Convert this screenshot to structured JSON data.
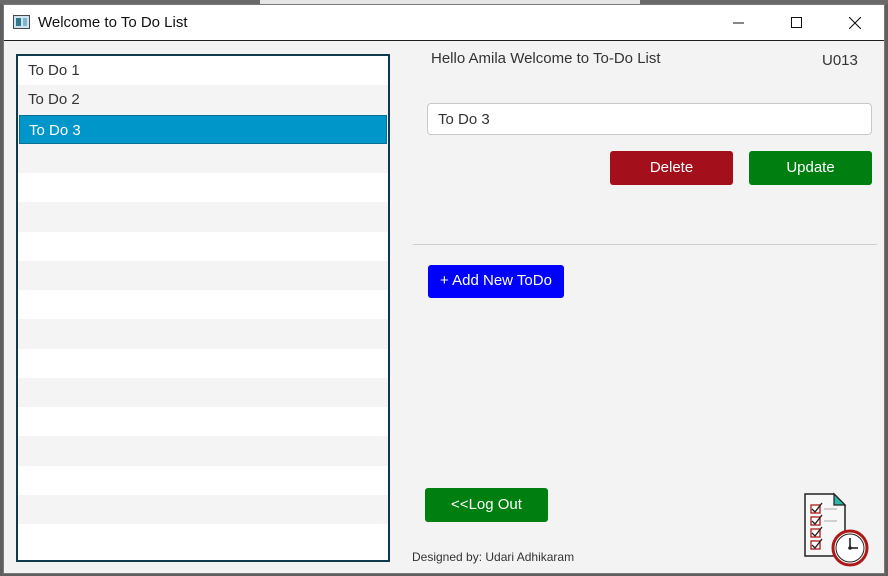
{
  "window": {
    "title": "Welcome to To Do List"
  },
  "todo_list": {
    "items": [
      "To Do 1",
      "To Do 2",
      "To Do 3"
    ],
    "selected_index": 2,
    "empty_rows": 14
  },
  "header": {
    "greeting": "Hello Amila Welcome to To-Do List",
    "user_id": "U013"
  },
  "editor": {
    "value": "To Do 3",
    "delete_label": "Delete",
    "update_label": "Update"
  },
  "actions": {
    "add_label": "+ Add New ToDo",
    "logout_label": "<<Log Out"
  },
  "footer": {
    "credit": "Designed by: Udari Adhikaram"
  },
  "icons": {
    "app": "app-window-icon",
    "minimize": "minimize-icon",
    "maximize": "maximize-icon",
    "close": "close-icon",
    "task": "task-clock-icon"
  },
  "colors": {
    "selection": "#0096c9",
    "delete": "#a40f1c",
    "update": "#007f11",
    "add": "#0000ff",
    "logout": "#007f11"
  }
}
